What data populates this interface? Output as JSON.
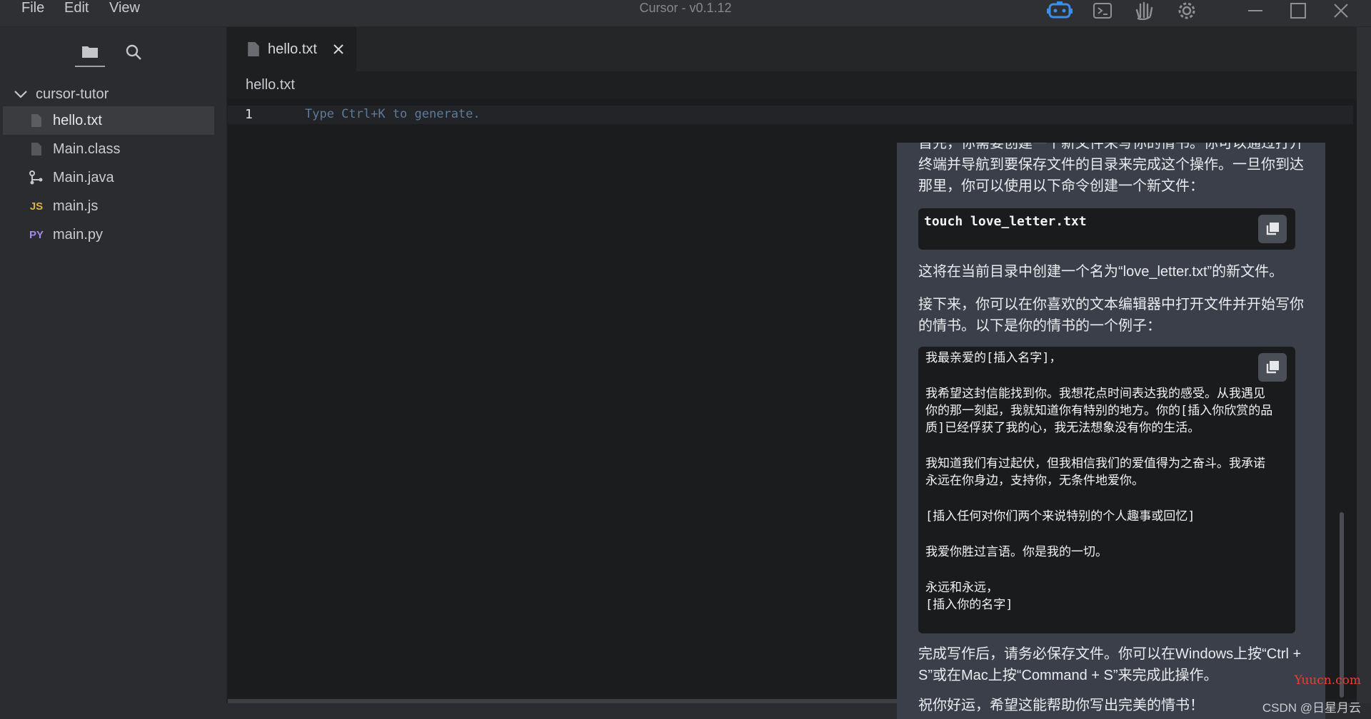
{
  "titlebar": {
    "menu": [
      "File",
      "Edit",
      "View"
    ],
    "title": "Cursor - v0.1.12",
    "icons": [
      "bot-icon",
      "terminal-icon",
      "hand-icon",
      "settings-gear-icon"
    ],
    "accent": "#3b8eea"
  },
  "sidebar": {
    "tabs": [
      "folder-icon",
      "search-icon"
    ],
    "root": "cursor-tutor",
    "files": [
      {
        "name": "hello.txt",
        "icon": "file-icon",
        "badge": "",
        "badge_color": "#8d9096"
      },
      {
        "name": "Main.class",
        "icon": "file-icon",
        "badge": "",
        "badge_color": "#8d9096"
      },
      {
        "name": "Main.java",
        "icon": "java-icon",
        "badge": "",
        "badge_color": "#c9cbce"
      },
      {
        "name": "main.js",
        "icon": "js-icon",
        "badge": "JS",
        "badge_color": "#d8b44a"
      },
      {
        "name": "main.py",
        "icon": "python-icon",
        "badge": "PY",
        "badge_color": "#a38ae8"
      }
    ]
  },
  "editor": {
    "tab": "hello.txt",
    "breadcrumb": "hello.txt",
    "line_number": "1",
    "placeholder": "Type Ctrl+K to generate."
  },
  "chat": {
    "p1_lines": [
      "首先，你需要创建一个新文件来写你的情书。你可以通过打开",
      "终端并导航到要保存文件的目录来完成这个操作。一旦你到达",
      "那里，你可以使用以下命令创建一个新文件："
    ],
    "code1": "touch love_letter.txt",
    "p2": "这将在当前目录中创建一个名为“love_letter.txt”的新文件。",
    "p3_lines": [
      "接下来，你可以在你喜欢的文本编辑器中打开文件并开始写你",
      "的情书。以下是你的情书的一个例子："
    ],
    "letter": [
      "我最亲爱的[插入名字]，",
      "我希望这封信能找到你。我想花点时间表达我的感受。从我遇见",
      "你的那一刻起，我就知道你有特别的地方。你的[插入你欣赏的品",
      "质]已经俘获了我的心，我无法想象没有你的生活。",
      "我知道我们有过起伏，但我相信我们的爱值得为之奋斗。我承诺",
      "永远在你身边，支持你，无条件地爱你。",
      "[插入任何对你们两个来说特别的个人趣事或回忆]",
      "我爱你胜过言语。你是我的一切。",
      "永远和永远，",
      "[插入你的名字]"
    ],
    "p4_lines": [
      "完成写作后，请务必保存文件。你可以在Windows上按“Ctrl +",
      "S”或在Mac上按“Command + S”来完成此操作。"
    ],
    "p5": "祝你好运，希望这能帮助你写出完美的情书！"
  },
  "watermarks": {
    "yuucn": "Yuucn.com",
    "csdn": "CSDN @日星月云",
    "yuucn_color": "#e0442e"
  }
}
